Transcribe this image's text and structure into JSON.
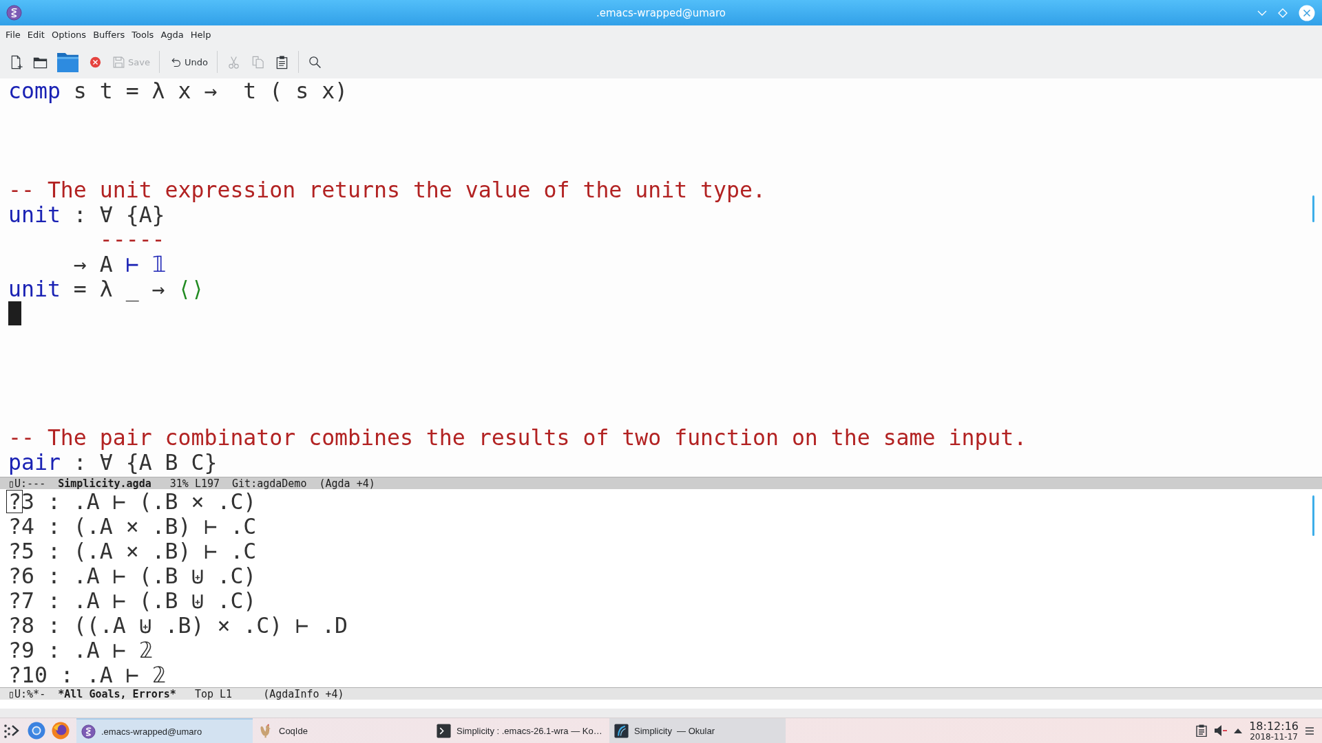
{
  "window": {
    "title": ".emacs-wrapped@umaro"
  },
  "menu": [
    "File",
    "Edit",
    "Options",
    "Buffers",
    "Tools",
    "Agda",
    "Help"
  ],
  "toolbar": {
    "groups": [
      [
        {
          "disabled": false
        },
        {
          "disabled": false
        },
        {
          "disabled": false
        },
        {
          "disabled": false
        },
        {
          "label": "Save",
          "disabled": true
        }
      ],
      [
        {
          "label": "Undo",
          "disabled": false
        }
      ],
      [
        {
          "disabled": true
        },
        {
          "disabled": true
        },
        {
          "disabled": false
        }
      ],
      [
        {
          "disabled": false
        }
      ]
    ]
  },
  "windows": [
    {
      "active": true,
      "lines": [
        {
          "kind": "code",
          "cursor": false,
          "tokens": [
            {
              "text": "comp",
              "kind": "name"
            },
            {
              "text": " s t = λ x →  t ( s x)",
              "kind": "plain"
            }
          ]
        },
        {
          "kind": "blank",
          "cursor": false
        },
        {
          "kind": "blank",
          "cursor": false
        },
        {
          "kind": "blank",
          "cursor": false
        },
        {
          "kind": "code",
          "cursor": false,
          "tokens": [
            {
              "text": "-- The unit expression returns the value of the unit type.",
              "kind": "comment"
            }
          ]
        },
        {
          "kind": "code",
          "cursor": false,
          "tokens": [
            {
              "text": "unit",
              "kind": "name"
            },
            {
              "text": " : ∀ {A}",
              "kind": "plain"
            }
          ]
        },
        {
          "kind": "code",
          "cursor": false,
          "tokens": [
            {
              "text": "       -----",
              "kind": "comment"
            }
          ]
        },
        {
          "kind": "code",
          "cursor": false,
          "tokens": [
            {
              "text": "     → A ",
              "kind": "plain"
            },
            {
              "text": "⊢ 𝟙",
              "kind": "name"
            }
          ]
        },
        {
          "kind": "code",
          "cursor": false,
          "tokens": [
            {
              "text": "unit",
              "kind": "name"
            },
            {
              "text": " = λ _ → ",
              "kind": "plain"
            },
            {
              "text": "⟨⟩",
              "kind": "constructor"
            }
          ]
        },
        {
          "kind": "blank",
          "cursor": true
        },
        {
          "kind": "blank",
          "cursor": false
        },
        {
          "kind": "blank",
          "cursor": false
        },
        {
          "kind": "blank",
          "cursor": false
        },
        {
          "kind": "blank",
          "cursor": false
        },
        {
          "kind": "code",
          "cursor": false,
          "tokens": [
            {
              "text": "-- The pair combinator combines the results of two function on the same input.",
              "kind": "comment"
            }
          ]
        },
        {
          "kind": "code",
          "cursor": false,
          "tokens": [
            {
              "text": "pair",
              "kind": "name"
            },
            {
              "text": " : ∀ {A B C}",
              "kind": "plain"
            }
          ]
        }
      ],
      "mode_line": [
        {
          "text": "▯U:---",
          "kind": "status"
        },
        {
          "text": "Simplicity.agda",
          "kind": "buffer"
        },
        {
          "text": "31% L197",
          "kind": "position"
        },
        {
          "text": "Git:agdaDemo",
          "kind": "vc"
        },
        {
          "text": "(Agda +4)",
          "kind": "mode"
        }
      ]
    },
    {
      "active": false,
      "lines": [
        {
          "kind": "code",
          "cursor": true,
          "tokens": [
            {
              "text": "?3 : .A ⊢ (.B × .C)",
              "kind": "plain"
            }
          ]
        },
        {
          "kind": "code",
          "cursor": false,
          "tokens": [
            {
              "text": "?4 : (.A × .B) ⊢ .C",
              "kind": "plain"
            }
          ]
        },
        {
          "kind": "code",
          "cursor": false,
          "tokens": [
            {
              "text": "?5 : (.A × .B) ⊢ .C",
              "kind": "plain"
            }
          ]
        },
        {
          "kind": "code",
          "cursor": false,
          "tokens": [
            {
              "text": "?6 : .A ⊢ (.B ⊎ .C)",
              "kind": "plain"
            }
          ]
        },
        {
          "kind": "code",
          "cursor": false,
          "tokens": [
            {
              "text": "?7 : .A ⊢ (.B ⊎ .C)",
              "kind": "plain"
            }
          ]
        },
        {
          "kind": "code",
          "cursor": false,
          "tokens": [
            {
              "text": "?8 : ((.A ⊎ .B) × .C) ⊢ .D",
              "kind": "plain"
            }
          ]
        },
        {
          "kind": "code",
          "cursor": false,
          "tokens": [
            {
              "text": "?9 : .A ⊢ 𝟚",
              "kind": "plain"
            }
          ]
        },
        {
          "kind": "code",
          "cursor": false,
          "tokens": [
            {
              "text": "?10 : .A ⊢ 𝟚",
              "kind": "plain"
            }
          ]
        }
      ],
      "mode_line": [
        {
          "text": "▯U:%*-",
          "kind": "status"
        },
        {
          "text": "*All Goals, Errors*",
          "kind": "buffer"
        },
        {
          "text": "Top L1",
          "kind": "position"
        },
        {
          "text": "(AgdaInfo +4)",
          "kind": "mode"
        }
      ]
    }
  ],
  "taskbar": {
    "tasks": [
      {
        "label": ".emacs-wrapped@umaro",
        "selected": true,
        "highlighted": false
      },
      {
        "label": "CoqIde",
        "selected": false,
        "highlighted": false
      },
      {
        "label": "Simplicity : .emacs-26.1-wra — Ko…",
        "selected": false,
        "highlighted": false
      },
      {
        "label": "Simplicity  — Okular",
        "selected": false,
        "highlighted": true
      }
    ],
    "tray": {
      "volume_muted": true
    },
    "clock": {
      "time": "18:12:16",
      "date": "2018-11-17"
    }
  }
}
